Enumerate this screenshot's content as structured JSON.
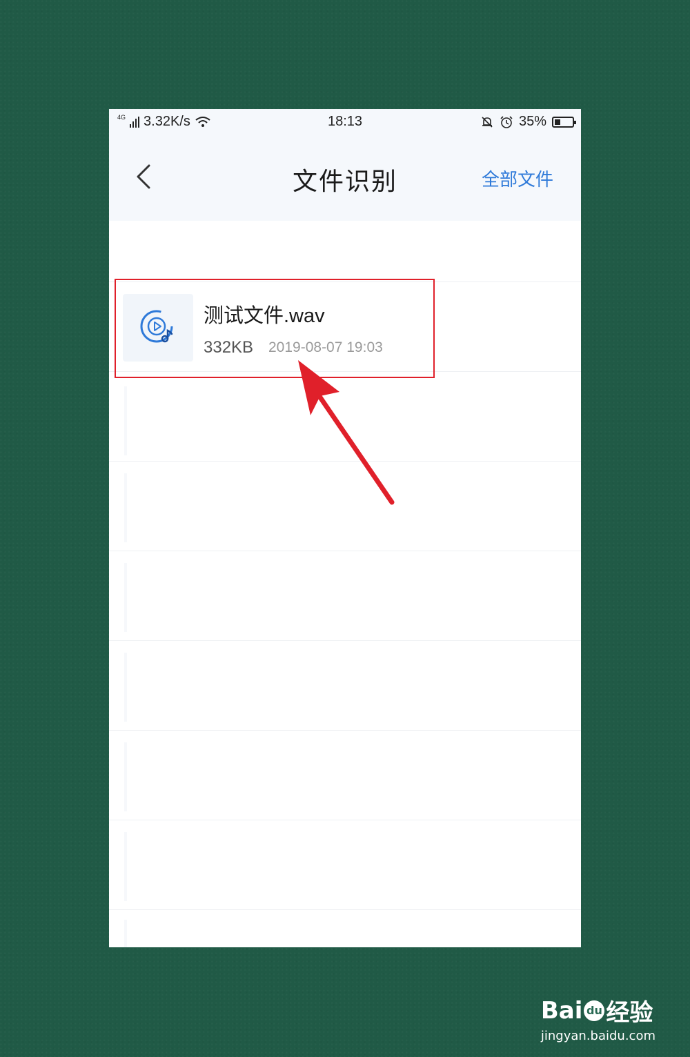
{
  "status_bar": {
    "network": "4G",
    "speed": "3.32K/s",
    "time": "18:13",
    "battery_percent": "35%",
    "battery_level": 0.35,
    "icons": [
      "signal-icon",
      "wifi-icon",
      "mute-bell-icon",
      "alarm-icon",
      "battery-icon"
    ]
  },
  "header": {
    "back_icon": "chevron-left-icon",
    "title": "文件识别",
    "all_files_label": "全部文件"
  },
  "files": [
    {
      "name": "测试文件.wav",
      "size": "332KB",
      "date": "2019-08-07 19:03",
      "icon": "audio-file-icon"
    }
  ],
  "watermark": {
    "brand_left": "Bai",
    "brand_mid": "du",
    "brand_right": "经验",
    "url": "jingyan.baidu.com"
  },
  "colors": {
    "accent": "#2f7ad9",
    "highlight": "#e0202a",
    "header_bg": "#f5f8fc",
    "background": "#205a46"
  }
}
